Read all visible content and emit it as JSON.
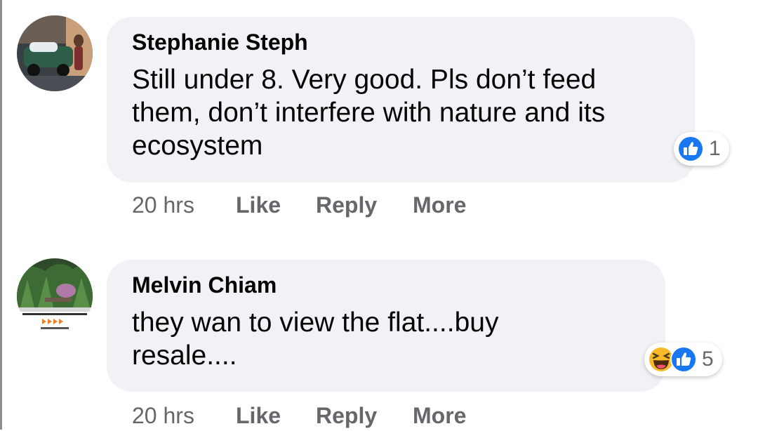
{
  "comments": [
    {
      "author": "Stephanie Steph",
      "text": "Still under 8. Very good. Pls don’t feed them, don’t interfere with nature and its ecosystem",
      "reaction_icons": [
        "like-icon"
      ],
      "reaction_count": "1",
      "timestamp": "20 hrs",
      "actions": {
        "like": "Like",
        "reply": "Reply",
        "more": "More"
      }
    },
    {
      "author": "Melvin Chiam",
      "text": "they wan to view the flat....buy resale....",
      "reaction_icons": [
        "haha-icon",
        "like-icon"
      ],
      "reaction_count": "5",
      "timestamp": "20 hrs",
      "actions": {
        "like": "Like",
        "reply": "Reply",
        "more": "More"
      }
    }
  ],
  "colors": {
    "bubble": "#f0f2f5",
    "text": "#050505",
    "meta": "#65676b",
    "like_blue": "#1877f2",
    "haha_yellow": "#f7b928"
  }
}
